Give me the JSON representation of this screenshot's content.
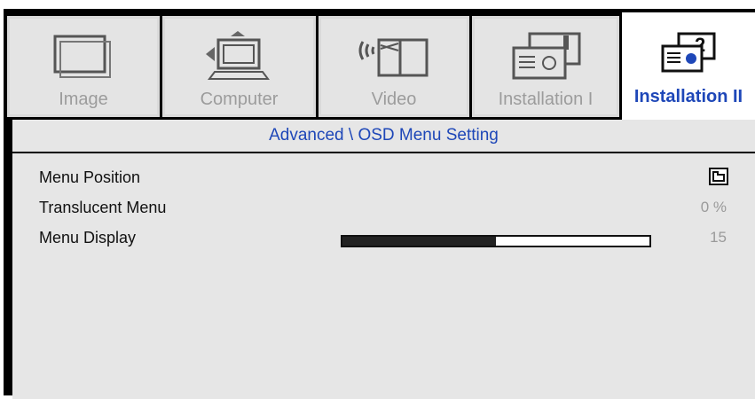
{
  "tabs": [
    {
      "label": "Image",
      "icon": "image-icon",
      "active": false
    },
    {
      "label": "Computer",
      "icon": "computer-icon",
      "active": false
    },
    {
      "label": "Video",
      "icon": "video-icon",
      "active": false
    },
    {
      "label": "Installation I",
      "icon": "installation-icon",
      "active": false
    },
    {
      "label": "Installation II",
      "icon": "installation-2-icon",
      "active": true
    }
  ],
  "breadcrumb": "Advanced \\ OSD Menu Setting",
  "settings": {
    "menu_position": {
      "label": "Menu Position",
      "icon": "menu-position-icon"
    },
    "translucent_menu": {
      "label": "Translucent Menu",
      "value": "0 %"
    },
    "menu_display": {
      "label": "Menu Display",
      "value": "15",
      "fraction": 0.5
    }
  },
  "colors": {
    "accent": "#1e47b8",
    "panel": "#e6e6e6",
    "inactive_text": "#9c9c9c"
  }
}
